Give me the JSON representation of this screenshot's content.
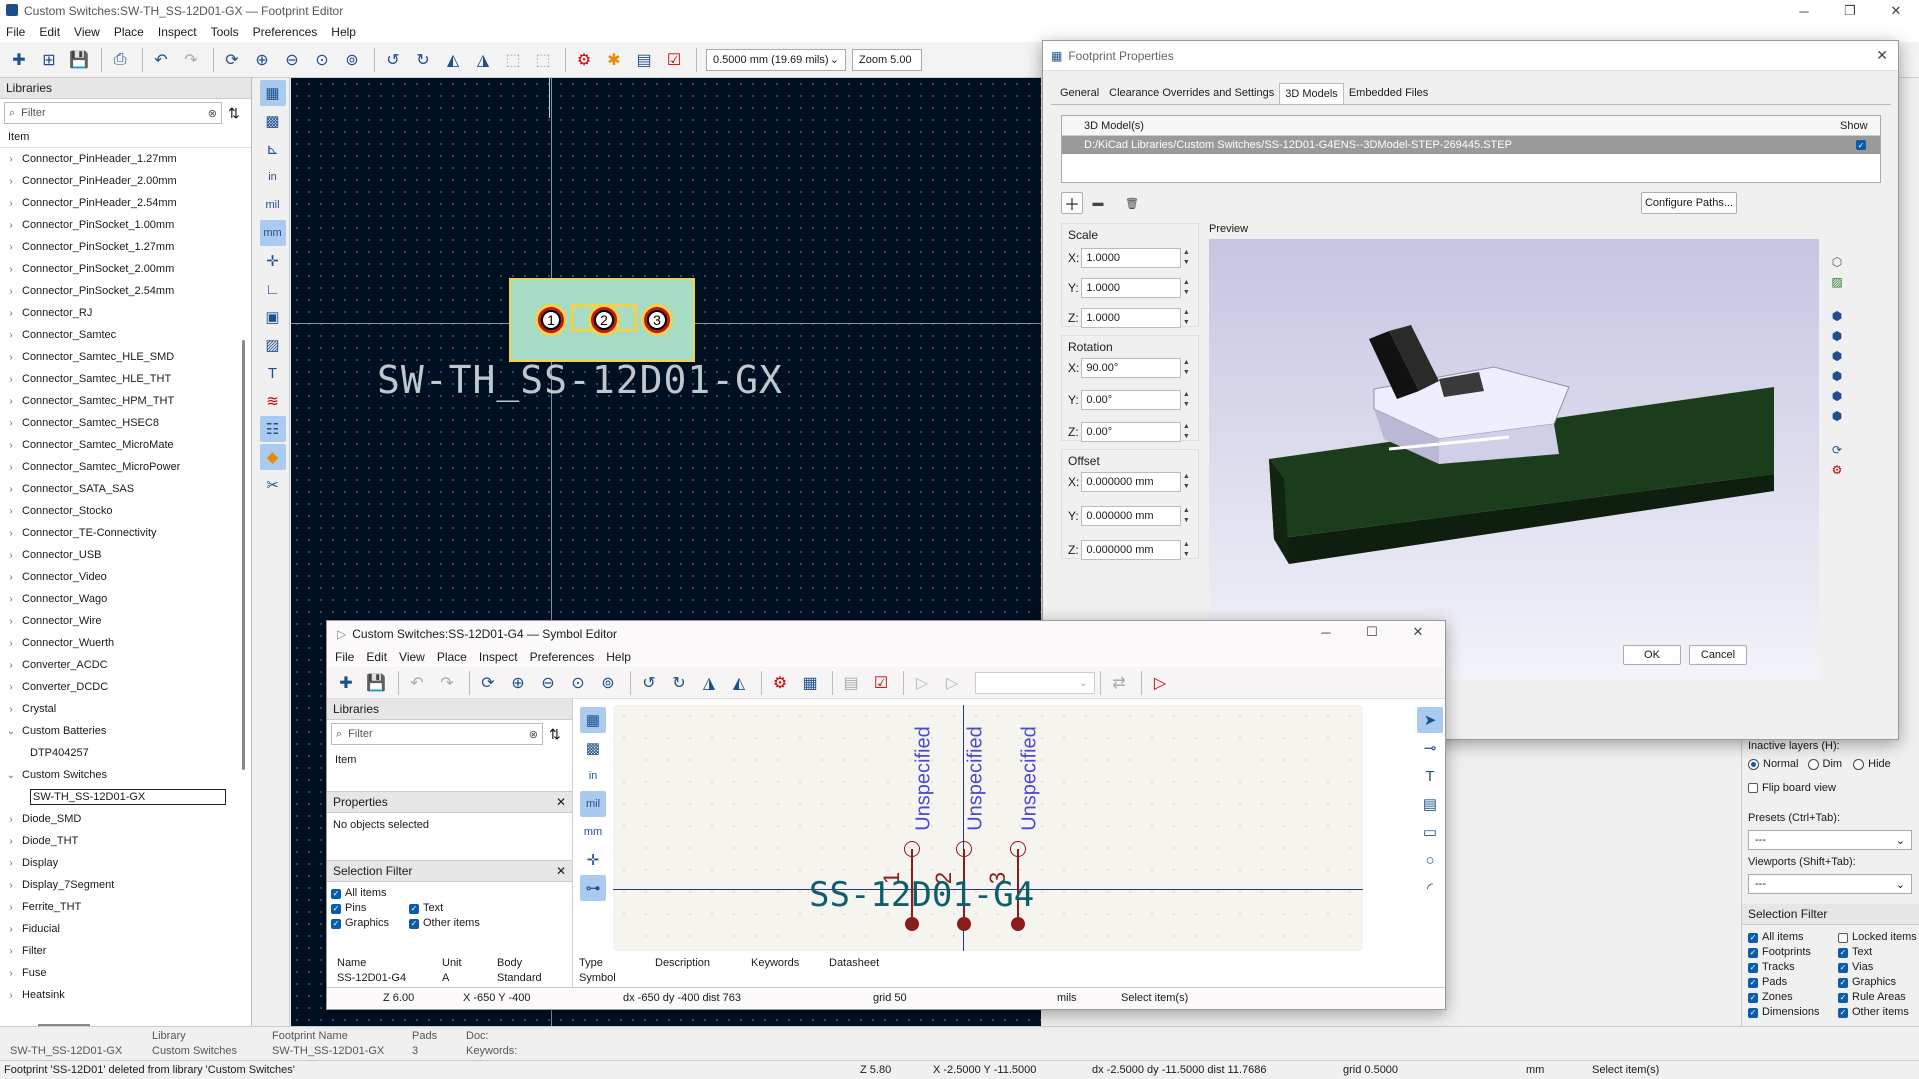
{
  "window": {
    "title": "Custom Switches:SW-TH_SS-12D01-GX — Footprint Editor"
  },
  "menu": [
    "File",
    "Edit",
    "View",
    "Place",
    "Inspect",
    "Tools",
    "Preferences",
    "Help"
  ],
  "toolbar": {
    "grid_value": "0.5000 mm (19.69 mils)",
    "zoom_value": "Zoom 5.00"
  },
  "libraries": {
    "header": "Libraries",
    "filter_placeholder": "Filter",
    "col_header": "Item",
    "items": [
      {
        "label": "Connector_PinHeader_1.27mm",
        "chev": "›",
        "indent": 0
      },
      {
        "label": "Connector_PinHeader_2.00mm",
        "chev": "›",
        "indent": 0
      },
      {
        "label": "Connector_PinHeader_2.54mm",
        "chev": "›",
        "indent": 0
      },
      {
        "label": "Connector_PinSocket_1.00mm",
        "chev": "›",
        "indent": 0
      },
      {
        "label": "Connector_PinSocket_1.27mm",
        "chev": "›",
        "indent": 0
      },
      {
        "label": "Connector_PinSocket_2.00mm",
        "chev": "›",
        "indent": 0
      },
      {
        "label": "Connector_PinSocket_2.54mm",
        "chev": "›",
        "indent": 0
      },
      {
        "label": "Connector_RJ",
        "chev": "›",
        "indent": 0
      },
      {
        "label": "Connector_Samtec",
        "chev": "›",
        "indent": 0
      },
      {
        "label": "Connector_Samtec_HLE_SMD",
        "chev": "›",
        "indent": 0
      },
      {
        "label": "Connector_Samtec_HLE_THT",
        "chev": "›",
        "indent": 0
      },
      {
        "label": "Connector_Samtec_HPM_THT",
        "chev": "›",
        "indent": 0
      },
      {
        "label": "Connector_Samtec_HSEC8",
        "chev": "›",
        "indent": 0
      },
      {
        "label": "Connector_Samtec_MicroMate",
        "chev": "›",
        "indent": 0
      },
      {
        "label": "Connector_Samtec_MicroPower",
        "chev": "›",
        "indent": 0
      },
      {
        "label": "Connector_SATA_SAS",
        "chev": "›",
        "indent": 0
      },
      {
        "label": "Connector_Stocko",
        "chev": "›",
        "indent": 0
      },
      {
        "label": "Connector_TE-Connectivity",
        "chev": "›",
        "indent": 0
      },
      {
        "label": "Connector_USB",
        "chev": "›",
        "indent": 0
      },
      {
        "label": "Connector_Video",
        "chev": "›",
        "indent": 0
      },
      {
        "label": "Connector_Wago",
        "chev": "›",
        "indent": 0
      },
      {
        "label": "Connector_Wire",
        "chev": "›",
        "indent": 0
      },
      {
        "label": "Connector_Wuerth",
        "chev": "›",
        "indent": 0
      },
      {
        "label": "Converter_ACDC",
        "chev": "›",
        "indent": 0
      },
      {
        "label": "Converter_DCDC",
        "chev": "›",
        "indent": 0
      },
      {
        "label": "Crystal",
        "chev": "›",
        "indent": 0
      },
      {
        "label": "Custom Batteries",
        "chev": "⌄",
        "indent": 0
      },
      {
        "label": "DTP404257",
        "chev": "",
        "indent": 1
      },
      {
        "label": "Custom Switches",
        "chev": "⌄",
        "indent": 0
      },
      {
        "label": "SW-TH_SS-12D01-GX",
        "chev": "",
        "indent": 1,
        "selected": true
      },
      {
        "label": "Diode_SMD",
        "chev": "›",
        "indent": 0
      },
      {
        "label": "Diode_THT",
        "chev": "›",
        "indent": 0
      },
      {
        "label": "Display",
        "chev": "›",
        "indent": 0
      },
      {
        "label": "Display_7Segment",
        "chev": "›",
        "indent": 0
      },
      {
        "label": "Ferrite_THT",
        "chev": "›",
        "indent": 0
      },
      {
        "label": "Fiducial",
        "chev": "›",
        "indent": 0
      },
      {
        "label": "Filter",
        "chev": "›",
        "indent": 0
      },
      {
        "label": "Fuse",
        "chev": "›",
        "indent": 0
      },
      {
        "label": "Heatsink",
        "chev": "›",
        "indent": 0
      }
    ]
  },
  "canvas": {
    "footprint_label": "SW-TH_SS-12D01-GX",
    "pads": [
      "1",
      "2",
      "3"
    ]
  },
  "footprint_props": {
    "title": "Footprint Properties",
    "tabs": [
      "General",
      "Clearance Overrides and Settings",
      "3D Models",
      "Embedded Files"
    ],
    "table_col1": "3D Model(s)",
    "table_col2": "Show",
    "model_path": "D:/KiCad Libraries/Custom Switches/SS-12D01-G4ENS--3DModel-STEP-269445.STEP",
    "configure_paths": "Configure Paths...",
    "scale_label": "Scale",
    "rotation_label": "Rotation",
    "offset_label": "Offset",
    "preview_label": "Preview",
    "scale": {
      "x": "1.0000",
      "y": "1.0000",
      "z": "1.0000"
    },
    "rotation": {
      "x": "90.00°",
      "y": "0.00°",
      "z": "0.00°"
    },
    "offset": {
      "x": "0.000000 mm",
      "y": "0.000000 mm",
      "z": "0.000000 mm"
    },
    "ok": "OK",
    "cancel": "Cancel"
  },
  "right_panel": {
    "inactive_layers": "Inactive layers (H):",
    "normal": "Normal",
    "dim": "Dim",
    "hide": "Hide",
    "flip": "Flip board view",
    "presets": "Presets (Ctrl+Tab):",
    "presets_val": "---",
    "viewports": "Viewports (Shift+Tab):",
    "viewports_val": "---",
    "selection_filter": "Selection Filter",
    "filters_left": [
      "All items",
      "Footprints",
      "Tracks",
      "Pads",
      "Zones",
      "Dimensions"
    ],
    "filters_right": [
      "Locked items",
      "Text",
      "Vias",
      "Graphics",
      "Rule Areas",
      "Other items"
    ]
  },
  "symbol_editor": {
    "title": "Custom Switches:SS-12D01-G4 — Symbol Editor",
    "menu": [
      "File",
      "Edit",
      "View",
      "Place",
      "Inspect",
      "Preferences",
      "Help"
    ],
    "libraries": "Libraries",
    "filter": "Filter",
    "item": "Item",
    "properties": "Properties",
    "no_objects": "No objects selected",
    "selection_filter": "Selection Filter",
    "filters": {
      "all": "All items",
      "pins": "Pins",
      "graphics": "Graphics",
      "text": "Text",
      "other": "Other items"
    },
    "info_headers": [
      "Name",
      "Unit",
      "Body",
      "Type",
      "Description",
      "Keywords",
      "Datasheet"
    ],
    "info_values": [
      "SS-12D01-G4",
      "A",
      "Standard",
      "Symbol"
    ],
    "pin_types": [
      "Unspecified",
      "Unspecified",
      "Unspecified"
    ],
    "pin_numbers": [
      "1",
      "2",
      "3"
    ],
    "symbol_label": "SS-12D01-G4",
    "status": {
      "zoom": "Z 6.00",
      "xy": "X -650  Y -400",
      "dxy": "dx -650  dy -400  dist 763",
      "grid": "grid 50",
      "units": "mils",
      "mode": "Select item(s)"
    }
  },
  "info_bar": {
    "library_hdr": "Library",
    "library_val": "Custom Switches",
    "fp_name_hdr": "Footprint Name",
    "fp_name_val": "SW-TH_SS-12D01-GX",
    "pads_hdr": "Pads",
    "pads_val": "3",
    "doc_hdr": "Doc:",
    "keywords_hdr": "Keywords:",
    "left_name": "SW-TH_SS-12D01-GX"
  },
  "status": {
    "message": "Footprint 'SS-12D01' deleted from library 'Custom Switches'",
    "zoom": "Z 5.80",
    "xy": "X -2.5000  Y -11.5000",
    "dxy": "dx -2.5000  dy -11.5000  dist 11.7686",
    "grid": "grid 0.5000",
    "units": "mm",
    "mode": "Select item(s)"
  }
}
